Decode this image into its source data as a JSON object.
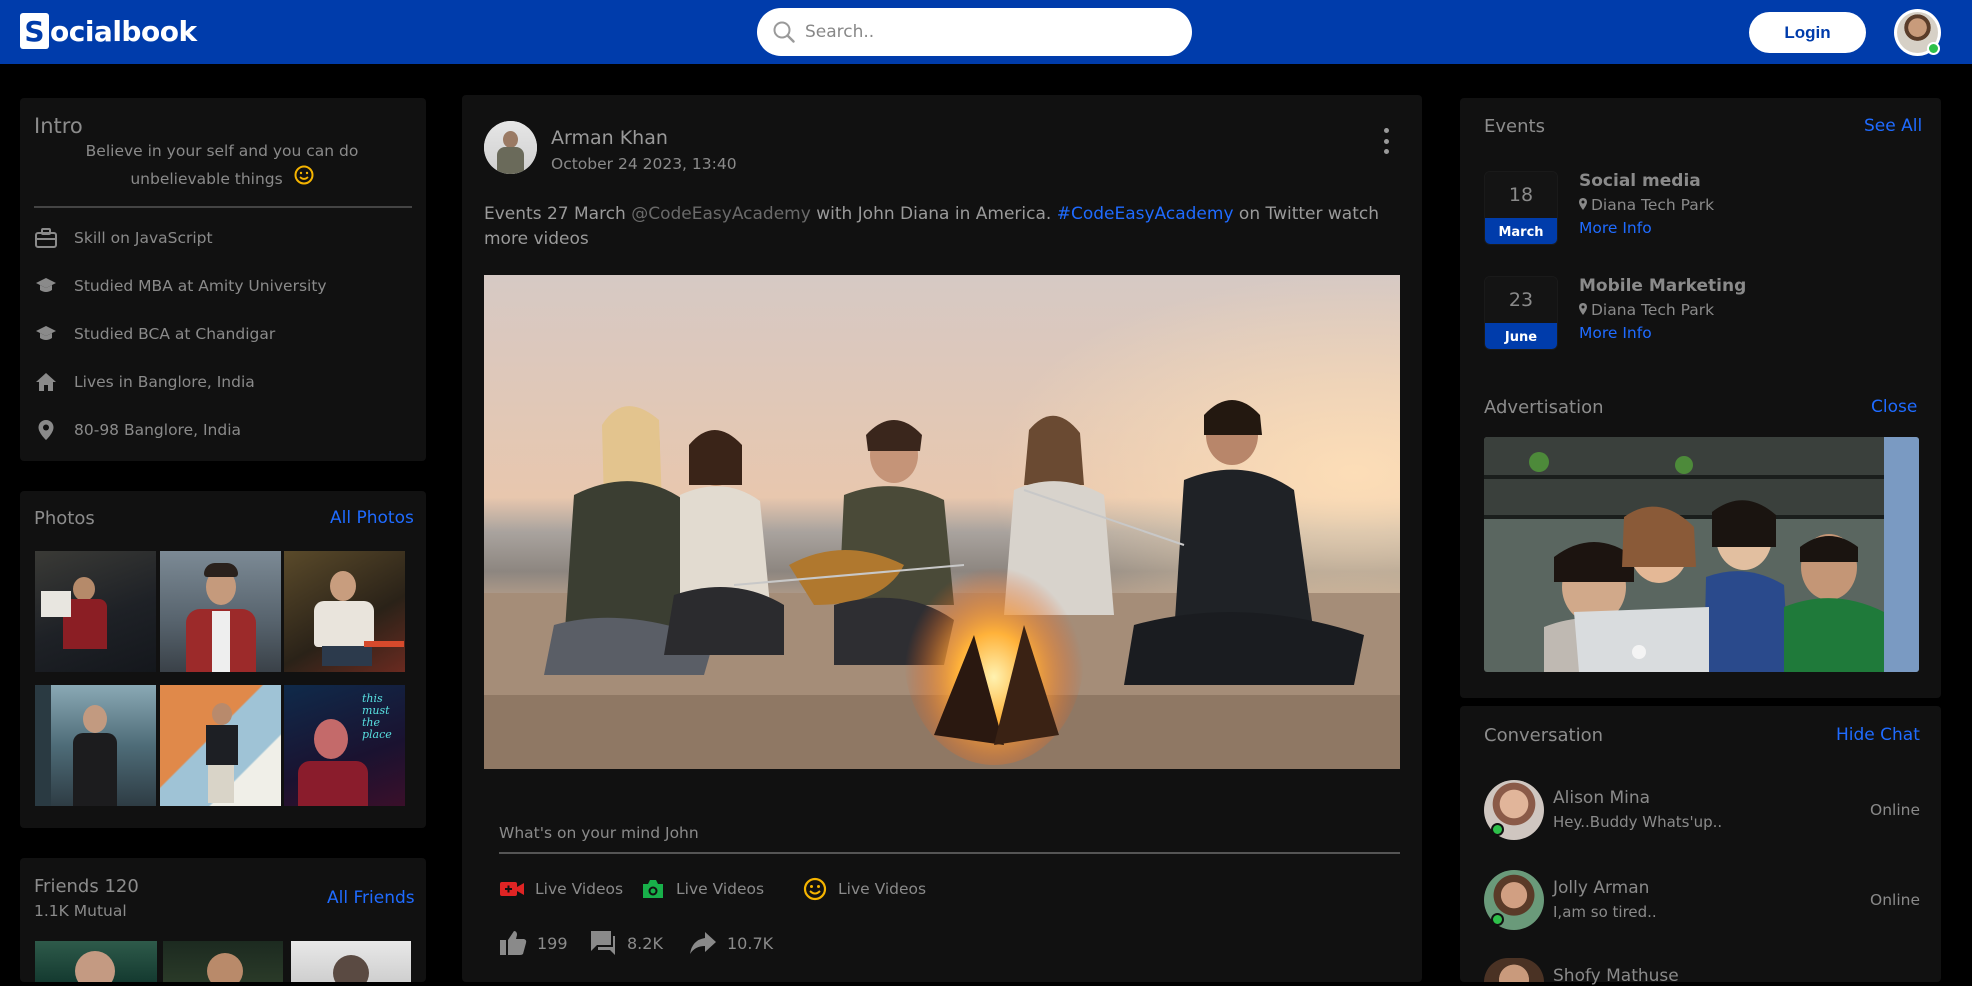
{
  "header": {
    "logo_letter": "S",
    "logo_text": "ocialbook",
    "search_placeholder": "Search..",
    "login_label": "Login"
  },
  "intro": {
    "title": "Intro",
    "quote": "Believe in your self and you can do unbelievable things",
    "items": [
      {
        "icon": "briefcase-icon",
        "label": "Skill on JavaScript"
      },
      {
        "icon": "graduation-cap-icon",
        "label": "Studied MBA at Amity University"
      },
      {
        "icon": "graduation-cap-icon",
        "label": "Studied BCA at Chandigar"
      },
      {
        "icon": "home-icon",
        "label": "Lives in Banglore, India"
      },
      {
        "icon": "location-pin-icon",
        "label": "80-98 Banglore, India"
      }
    ]
  },
  "photos": {
    "title": "Photos",
    "link": "All Photos"
  },
  "friends": {
    "title": "Friends 120",
    "mutual": "1.1K Mutual",
    "link": "All Friends"
  },
  "post": {
    "author": "Arman Khan",
    "date": "October 24 2023, 13:40",
    "text_a": "Events 27 March ",
    "mention": "@CodeEasyAcademy",
    "text_b": " with John Diana in America. ",
    "hashtag": "#CodeEasyAcademy",
    "text_c": " on Twitter watch more videos",
    "mind_placeholder": "What's on your mind John",
    "actions": [
      {
        "icon": "video-camera-icon",
        "label": "Live Videos",
        "color": "#e02424"
      },
      {
        "icon": "camera-icon",
        "label": "Live Videos",
        "color": "#18b04a"
      },
      {
        "icon": "smiley-icon",
        "label": "Live Videos",
        "color": "#f5b400"
      }
    ],
    "reactions": {
      "likes": "199",
      "comments": "8.2K",
      "shares": "10.7K"
    }
  },
  "events": {
    "title": "Events",
    "link": "See All",
    "items": [
      {
        "day": "18",
        "month": "March",
        "title": "Social media",
        "place": "Diana Tech Park",
        "more": "More Info"
      },
      {
        "day": "23",
        "month": "June",
        "title": "Mobile Marketing",
        "place": "Diana Tech Park",
        "more": "More Info"
      }
    ]
  },
  "advertisement": {
    "title": "Advertisation",
    "link": "Close"
  },
  "conversation": {
    "title": "Conversation",
    "link": "Hide Chat",
    "items": [
      {
        "name": "Alison Mina",
        "message": "Hey..Buddy Whats'up..",
        "status": "Online"
      },
      {
        "name": "Jolly Arman",
        "message": "I,am so tired..",
        "status": "Online"
      },
      {
        "name": "Shofy Mathuse",
        "message": "",
        "status": ""
      }
    ]
  },
  "colors": {
    "brand": "#003cab",
    "link": "#1f6bff",
    "online": "#2ec04a"
  }
}
